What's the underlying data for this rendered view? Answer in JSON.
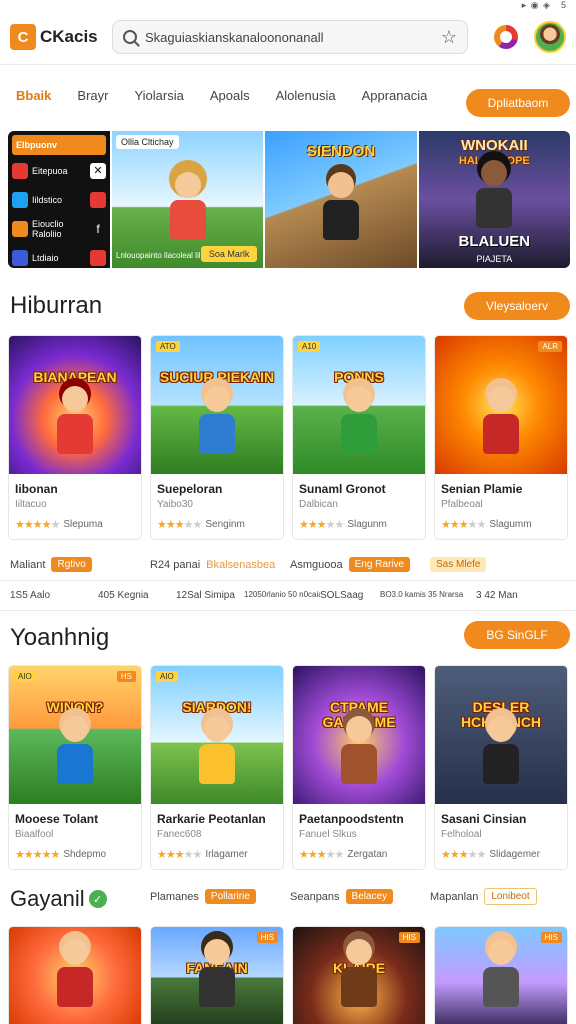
{
  "status": {
    "left": "",
    "right": "5"
  },
  "header": {
    "logo_mark": "C",
    "logo_text": "CKacis",
    "search_value": "Skaguiaskianskanaloononanall"
  },
  "tabs": {
    "items": [
      "Bbaik",
      "Brayr",
      "Yiolarsia",
      "Apoals",
      "Alolenusia",
      "Appranacia"
    ],
    "cta": "Dpliatbaom"
  },
  "banner": {
    "side_head": "Elbpuonv",
    "side_rows": [
      "Eitepuoa",
      "Iildstico",
      "Eiouclio Raloliio",
      "Ltdiaio"
    ],
    "panel1_tag": "Ollia Cltichay",
    "panel1_caption": "Lnlouopainto llacoleal lil ctelo",
    "panel1_button": "Soa Marlk",
    "panel2_title": "SIENDON",
    "panel3_title": "WNOKAII",
    "panel3_title2": "HALMUROPE",
    "panel3_sub": "BLALUEN",
    "panel3_sub2": "PIAJETA"
  },
  "section1": {
    "title": "Hiburran",
    "cta": "Vleysaloerv",
    "cards": [
      {
        "art_title": "BIANAPEAN",
        "tag": "",
        "tag_l": "",
        "name": "Iibonan",
        "sub": "Iiltacuo",
        "rating_label": "Slepuma",
        "stars": 4
      },
      {
        "art_title": "SUCIUR PIEKAIN",
        "tag": "",
        "tag_l": "ATO",
        "name": "Suepeloran",
        "sub": "Yaibo30",
        "rating_label": "Senginm",
        "stars": 3
      },
      {
        "art_title": "PONNS",
        "tag": "",
        "tag_l": "A10",
        "name": "Sunaml Gronot",
        "sub": "Dalbican",
        "rating_label": "Slagunm",
        "stars": 3
      },
      {
        "art_title": "",
        "tag": "ALR",
        "tag_l": "",
        "name": "Senian Plamie",
        "sub": "Pfalbeoal",
        "rating_label": "Slagumm",
        "stars": 3
      }
    ]
  },
  "stats1": [
    {
      "label": "Maliant",
      "pill": "Rgtivo",
      "pill_style": "solid"
    },
    {
      "label": "R24 panai",
      "pill": "Bkalsenasbea",
      "pill_style": "text"
    },
    {
      "label": "Asmguooa",
      "pill": "Eng Rarive",
      "pill_style": "solid"
    },
    {
      "label": "",
      "pill": "Sas Mlefe",
      "pill_style": "light"
    }
  ],
  "stats2": [
    "1S5 Aalo",
    "405 Kegnia",
    "12Sal Simipa",
    "12050rlanio 50 n0caiac",
    "SOLSaag",
    "BO3.0 kamis 35 Nrarsa",
    "3 42 Man"
  ],
  "section2": {
    "title": "Yoanhnig",
    "cta": "BG SinGLF",
    "cards": [
      {
        "art_title": "WINON?",
        "tag": "HS",
        "tag_l": "AIO",
        "name": "Mooese Tolant",
        "sub": "Biaalfool",
        "rating_label": "Shdepmo",
        "stars": 5
      },
      {
        "art_title": "SIARDON!",
        "tag": "",
        "tag_l": "AIO",
        "name": "Rarkarie Peotanlan",
        "sub": "Fanec608",
        "rating_label": "Irlagamer",
        "stars": 3
      },
      {
        "art_title": "CTPAME GANSJIME",
        "tag": "",
        "tag_l": "",
        "name": "Paetanpoodstentn",
        "sub": "Fanuel Slkus",
        "rating_label": "Zergatan",
        "stars": 3
      },
      {
        "art_title": "DESLER HCHLONCH",
        "tag": "",
        "tag_l": "",
        "name": "Sasani Cinsian",
        "sub": "Felholoal",
        "rating_label": "Slidagemer",
        "stars": 3
      }
    ]
  },
  "section3": {
    "title": "Gayanil",
    "filters": [
      {
        "label": "Plamanes",
        "pill": "Pollaririe",
        "pill_style": "solid"
      },
      {
        "label": "Seanpans",
        "pill": "Belacey",
        "pill_style": "solid"
      },
      {
        "label": "Mapanlan",
        "pill": "Lonibeot",
        "pill_style": "outline"
      }
    ],
    "cards": [
      {
        "art_title": "",
        "tag": "",
        "tag_l": ""
      },
      {
        "art_title": "FANEAIN",
        "tag": "HIS",
        "tag_l": ""
      },
      {
        "art_title": "KLAIRE",
        "tag": "HIS",
        "tag_l": ""
      },
      {
        "art_title": "",
        "tag": "HIS",
        "tag_l": ""
      }
    ]
  },
  "colors": {
    "accent": "#f08a1c",
    "star": "#f5a623",
    "bg": "#ffffff"
  }
}
